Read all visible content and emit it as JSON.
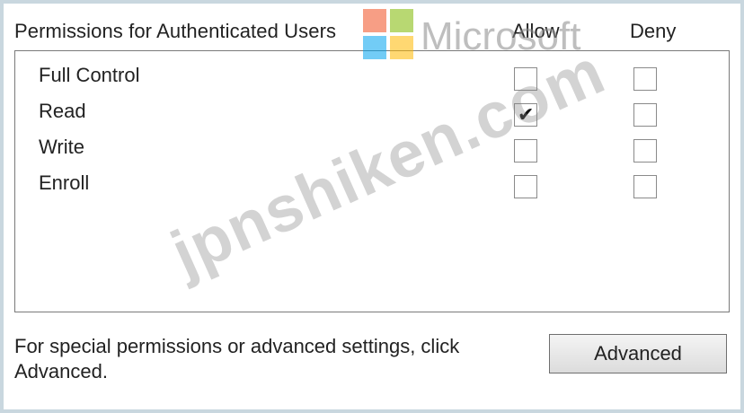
{
  "header": {
    "permissions_label": "Permissions for Authenticated Users",
    "allow_label": "Allow",
    "deny_label": "Deny"
  },
  "permissions": [
    {
      "label": "Full Control",
      "allow": false,
      "deny": false
    },
    {
      "label": "Read",
      "allow": true,
      "deny": false
    },
    {
      "label": "Write",
      "allow": false,
      "deny": false
    },
    {
      "label": "Enroll",
      "allow": false,
      "deny": false
    }
  ],
  "footer": {
    "text_line1": "For special permissions or advanced settings, click",
    "text_line2": "Advanced.",
    "advanced_button": "Advanced"
  },
  "watermarks": {
    "logo_text": "Microsoft",
    "logo_colors": [
      "#f25022",
      "#7fba00",
      "#00a4ef",
      "#ffb900"
    ],
    "site_text": "jpnshiken.com"
  }
}
